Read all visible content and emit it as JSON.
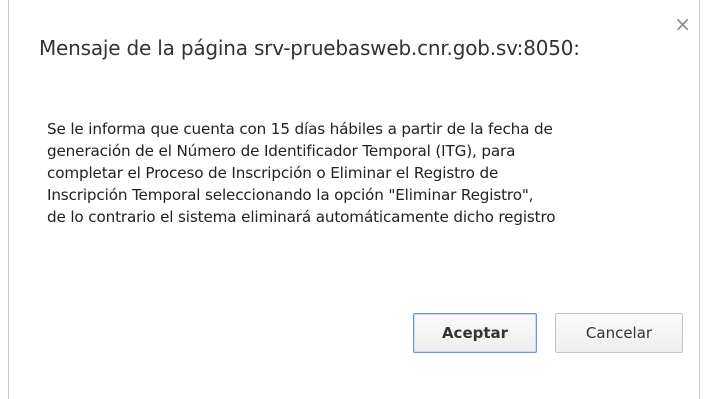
{
  "dialog": {
    "title": "Mensaje de la página srv-pruebasweb.cnr.gob.sv:8050:",
    "close_icon": "close-icon",
    "message_lines": [
      "Se le informa que cuenta con 15 días hábiles a partir de la fecha de",
      "generación de el Número de Identificador Temporal (ITG), para",
      "completar el Proceso de Inscripción o Eliminar el Registro de",
      "Inscripción Temporal seleccionando la opción  \"Eliminar Registro\",",
      "de lo contrario el sistema eliminará automáticamente dicho registro"
    ],
    "buttons": {
      "accept_label": "Aceptar",
      "cancel_label": "Cancelar"
    }
  }
}
